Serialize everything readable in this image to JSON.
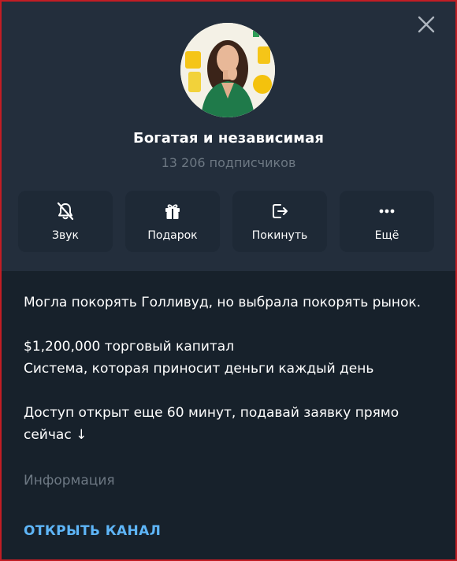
{
  "channel": {
    "name": "Богатая и независимая",
    "subscribers": "13 206 подписчиков"
  },
  "actions": [
    {
      "label": "Звук",
      "icon": "muted-bell-icon"
    },
    {
      "label": "Подарок",
      "icon": "gift-icon"
    },
    {
      "label": "Покинуть",
      "icon": "leave-icon"
    },
    {
      "label": "Ещё",
      "icon": "more-dots-icon"
    }
  ],
  "about": {
    "line1": "Могла покорять Голливуд, но выбрала покорять рынок.",
    "line2": "$1,200,000 торговый капитал",
    "line3": "Система, которая приносит деньги каждый день",
    "line4": "Доступ открыт еще 60 минут, подавай заявку прямо сейчас ↓",
    "caption": "Информация"
  },
  "open_channel_label": "ОТКРЫТЬ КАНАЛ",
  "colors": {
    "header_bg": "#232e3c",
    "body_bg": "#17212b",
    "button_bg": "#1e2936",
    "accent": "#5eb5f7",
    "muted_text": "#6d7883",
    "frame": "#c21d24"
  }
}
